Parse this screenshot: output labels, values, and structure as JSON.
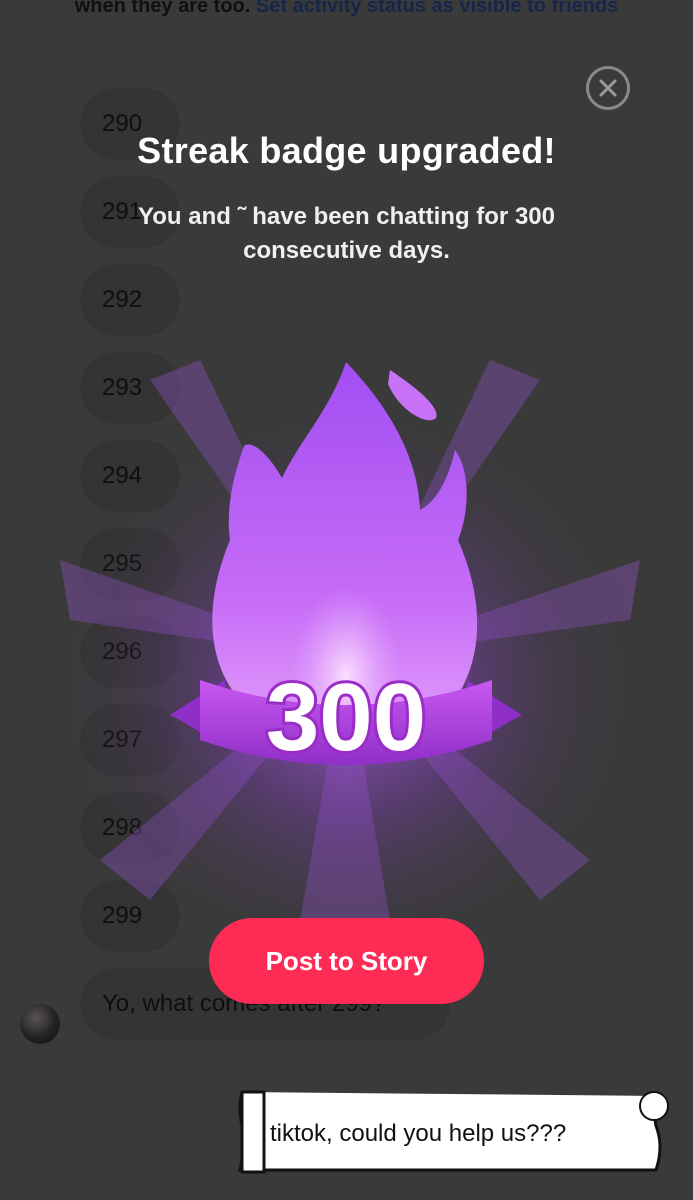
{
  "chat": {
    "activity_note_prefix": "when they are too.",
    "activity_note_link": "Set activity status as visible to friends",
    "messages": [
      "290",
      "291",
      "292",
      "293",
      "294",
      "295",
      "296",
      "297",
      "298",
      "299"
    ],
    "last_message": "Yo, what comes after 299?"
  },
  "modal": {
    "title": "Streak badge upgraded!",
    "subtitle": "You and ˜ have been chatting for 300 consecutive days.",
    "badge_number": "300",
    "post_button": "Post to Story"
  },
  "sticker": {
    "text": "tiktok, could you help us???"
  },
  "colors": {
    "accent": "#fe2c55",
    "flame": "#b14cf0",
    "overlay": "#3a3a3a"
  }
}
